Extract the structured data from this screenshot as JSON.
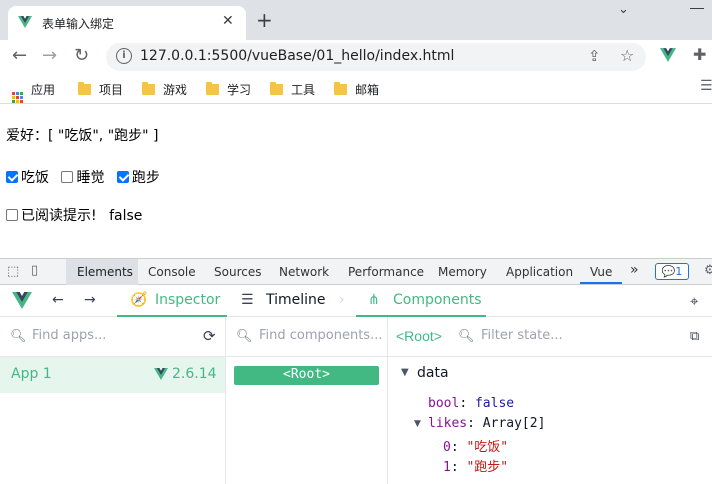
{
  "browser": {
    "tab_title": "表单输入绑定",
    "tab_close": "✕",
    "new_tab": "+",
    "tab_menu": "⌄",
    "url": "127.0.0.1:5500/vueBase/01_hello/index.html"
  },
  "bookmarks": [
    {
      "label": "应用",
      "icon": "apps-grid-icon"
    },
    {
      "label": "项目",
      "icon": "folder-icon"
    },
    {
      "label": "游戏",
      "icon": "folder-icon"
    },
    {
      "label": "学习",
      "icon": "folder-icon"
    },
    {
      "label": "工具",
      "icon": "folder-icon"
    },
    {
      "label": "邮箱",
      "icon": "folder-icon"
    }
  ],
  "page": {
    "hobby_text": "爱好：[ \"吃饭\", \"跑步\" ]",
    "checkboxes": [
      {
        "label": "吃饭",
        "checked": true
      },
      {
        "label": "睡觉",
        "checked": false
      },
      {
        "label": "跑步",
        "checked": true
      }
    ],
    "read_label": "已阅读提示!",
    "read_checked": false,
    "read_value": "false"
  },
  "devtools": {
    "tabs": [
      "Elements",
      "Console",
      "Sources",
      "Network",
      "Performance",
      "Memory",
      "Application",
      "Vue"
    ],
    "more": "»",
    "issues_count": "1"
  },
  "vue": {
    "inspector": "Inspector",
    "timeline": "Timeline",
    "components": "Components",
    "find_apps": "Find apps...",
    "find_components": "Find components...",
    "filter_state": "Filter state...",
    "app_name": "App 1",
    "vue_version": "2.6.14",
    "root_pill": "<Root>",
    "root_selected": "<Root>",
    "state_section": "data",
    "bool_key": "bool",
    "bool_value": "false",
    "likes_key": "likes",
    "likes_type": "Array[2]",
    "likes_items": [
      {
        "index": "0",
        "value": "\"吃饭\""
      },
      {
        "index": "1",
        "value": "\"跑步\""
      }
    ]
  },
  "colors": {
    "vue_green": "#42b883",
    "checkbox_blue": "#0075ff",
    "tab_strip": "#dee1e6"
  }
}
